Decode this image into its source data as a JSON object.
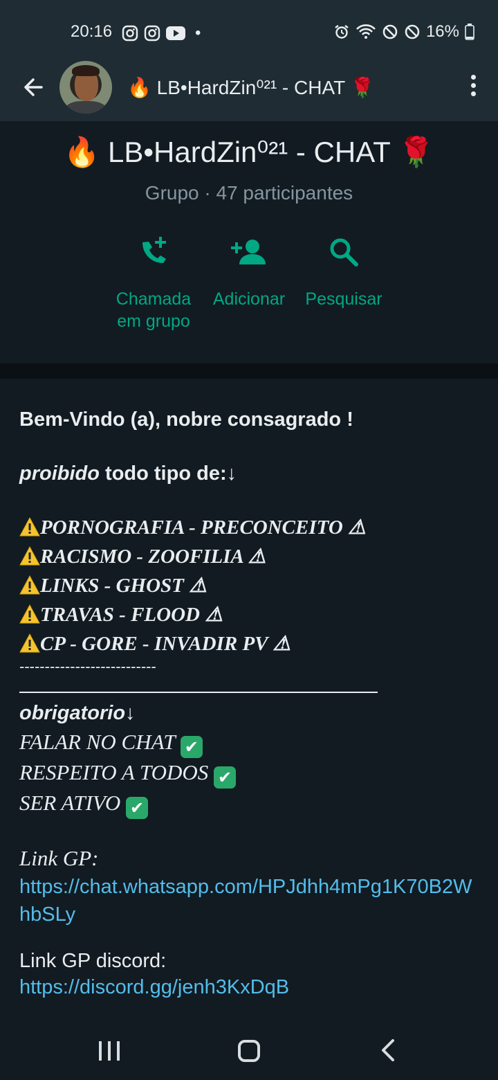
{
  "status_bar": {
    "time": "20:16",
    "dot": "•",
    "battery": "16%",
    "icons": [
      "instagram-icon",
      "instagram-icon",
      "youtube-icon",
      "alarm-icon",
      "wifi-icon",
      "block-icon",
      "block-icon",
      "battery-icon"
    ]
  },
  "header": {
    "title": "🔥 LB•HardZin⁰²¹ - CHAT 🌹"
  },
  "group": {
    "name": "🔥 LB•HardZin⁰²¹ - CHAT 🌹",
    "subtitle": "Grupo · 47 participantes",
    "actions": [
      {
        "label": "Chamada\nem grupo",
        "icon": "group-call-icon"
      },
      {
        "label": "Adicionar",
        "icon": "add-person-icon"
      },
      {
        "label": "Pesquisar",
        "icon": "search-icon"
      }
    ]
  },
  "description": {
    "welcome": "Bem-Vindo (a), nobre consagrado !",
    "prohibited_italic": "proibido",
    "prohibited_rest": " todo tipo de:↓",
    "rules": [
      "PORNOGRAFIA - PRECONCEITO ⚠",
      "RACISMO -  ZOOFILIA ⚠",
      "LINKS - GHOST ⚠",
      "TRAVAS - FLOOD ⚠",
      "CP - GORE - INVADIR PV ⚠"
    ],
    "dashes": "---------------------------",
    "mandatory": "obrigatorio↓",
    "mandatory_items": [
      "FALAR NO CHAT ",
      "RESPEITO A TODOS ",
      "SER ATIVO "
    ],
    "check_mark": "✔",
    "link_gp_label": "Link GP:",
    "link_gp": "https://chat.whatsapp.com/HPJdhh4mPg1K70B2WhbSLy",
    "link_discord_label": "Link GP discord:",
    "link_discord": "https://discord.gg/jenh3KxDqB"
  },
  "colors": {
    "accent": "#00a884",
    "link": "#53bdeb",
    "background": "#121b22",
    "header": "#1f2c34"
  }
}
